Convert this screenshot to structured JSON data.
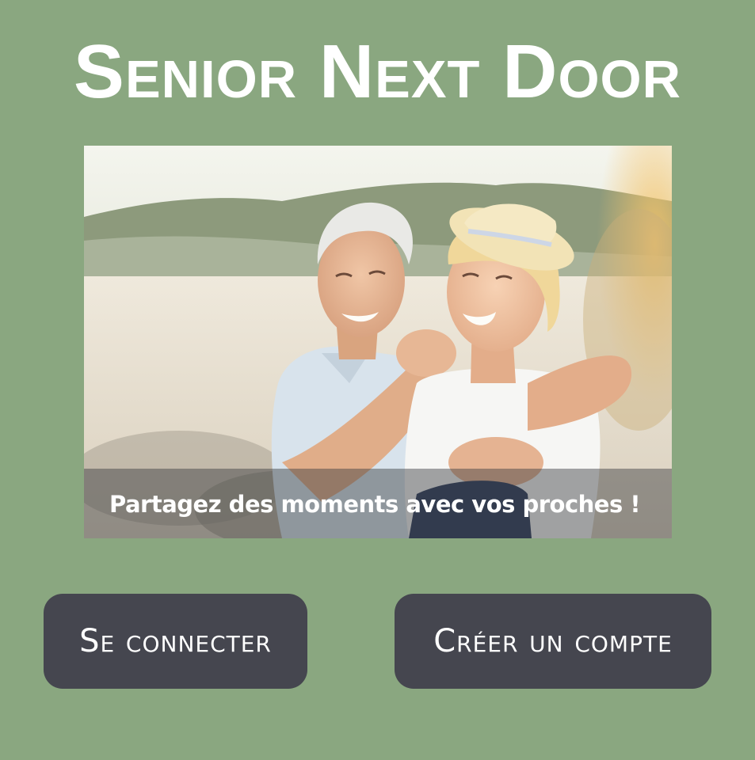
{
  "app": {
    "title": "Senior Next Door"
  },
  "hero": {
    "image": "senior-couple-laughing-photo",
    "caption": "Partagez des moments avec vos proches !"
  },
  "actions": {
    "login_label": "Se connecter",
    "signup_label": "Créer un compte"
  },
  "colors": {
    "background": "#8aa780",
    "button": "#45464f",
    "text": "#ffffff"
  }
}
